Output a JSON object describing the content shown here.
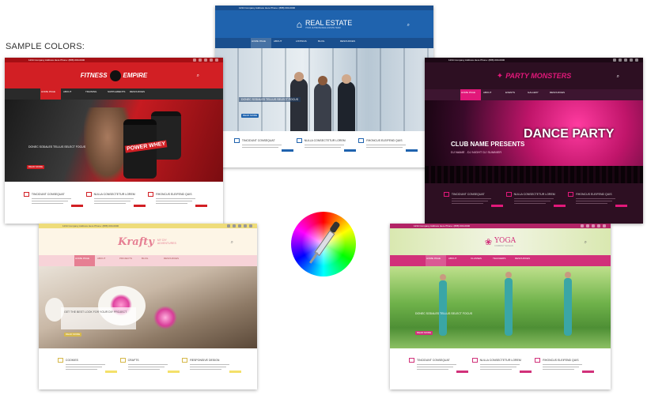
{
  "heading": "SAMPLE COLORS:",
  "cards": {
    "real_estate": {
      "brand": "REAL ESTATE",
      "brand_sub": "YOUR ULTIMATE REAL ESTATE TEAM",
      "topbar": "1234 Company Address Here Phone: (888) 000-0000",
      "nav": [
        "HOME PAGE",
        "ABOUT",
        "LISTINGS",
        "BLOG",
        "RESOURCES"
      ],
      "hero_line": "DONEC SODALES TELLUS SELECT FOCUS",
      "button": "READ MORE",
      "features": [
        "TINCIDUNT CONSEQUAT",
        "NULLA CONSECTETUR LOREM",
        "RHONCUS ELEIFEND QUIS"
      ],
      "colors": {
        "primary": "#1f63ae",
        "accent": "#1a4f8e"
      }
    },
    "fitness": {
      "brand_left": "FITNESS",
      "brand_right": "EMPIRE",
      "topbar": "1234 Company Address Here Phone: (888) 000-0000",
      "nav": [
        "HOME PAGE",
        "ABOUT",
        "TRAINING",
        "SUPPLEMENTS",
        "RESOURCES"
      ],
      "hero_line": "DONEC SODALES TELLUS SELECT FOCUS",
      "product": "POWER WHEY",
      "button": "READ MORE",
      "features": [
        "TINCIDUNT CONSEQUAT",
        "NULLA CONSECTETUR LOREM",
        "RHONCUS ELEIFEND QUIS"
      ],
      "colors": {
        "primary": "#d21f24",
        "accent": "#a50f14"
      }
    },
    "party": {
      "brand": "PARTY MONSTERS",
      "topbar": "1234 Company Address Here Phone: (888) 000-0000",
      "nav": [
        "HOME PAGE",
        "ABOUT",
        "EVENTS",
        "GALLERY",
        "RESOURCES"
      ],
      "hero_title": "CLUB NAME PRESENTS",
      "hero_sub": "DJ NAME . DJ NIGHT DJ SUMMER",
      "hero_big": "DANCE PARTY",
      "features": [
        "TINCIDUNT CONSEQUAT",
        "NULLA CONSECTETUR LOREM",
        "RHONCUS ELEIFEND QUIS"
      ],
      "colors": {
        "primary": "#e2187a",
        "accent": "#2d0f22"
      }
    },
    "krafty": {
      "brand": "Krafty",
      "brand_sub": "MY DIY ADVENTURES",
      "topbar": "1234 Company Address Here Phone: (888) 000-0000",
      "nav": [
        "HOME PAGE",
        "ABOUT",
        "PROJECTS",
        "BLOG",
        "RESOURCES"
      ],
      "hero_line": "GET THE BEST LOOK FOR YOUR DIY PROJECT",
      "button": "READ MORE",
      "features": [
        "COOKIES",
        "CRAFTS",
        "RESPONSIVE DESIGN"
      ],
      "colors": {
        "primary": "#e67f93",
        "accent": "#f4e06a"
      }
    },
    "yoga": {
      "brand": "YOGA",
      "brand_sub": "COMPANY SLOGAN",
      "topbar": "1234 Company Address Here Phone: (888) 000-0000",
      "nav": [
        "HOME PAGE",
        "ABOUT",
        "CLASSES",
        "TEACHERS",
        "RESOURCES"
      ],
      "hero_line": "DONEC SODALES TELLUS SELECT FOCUS",
      "button": "READ MORE",
      "features": [
        "TINCIDUNT CONSEQUAT",
        "NULLA CONSECTETUR LOREM",
        "RHONCUS ELEIFEND QUIS"
      ],
      "colors": {
        "primary": "#d1317a",
        "accent": "#b22466"
      }
    }
  },
  "center_icon": "color-wheel-eyedropper-icon"
}
